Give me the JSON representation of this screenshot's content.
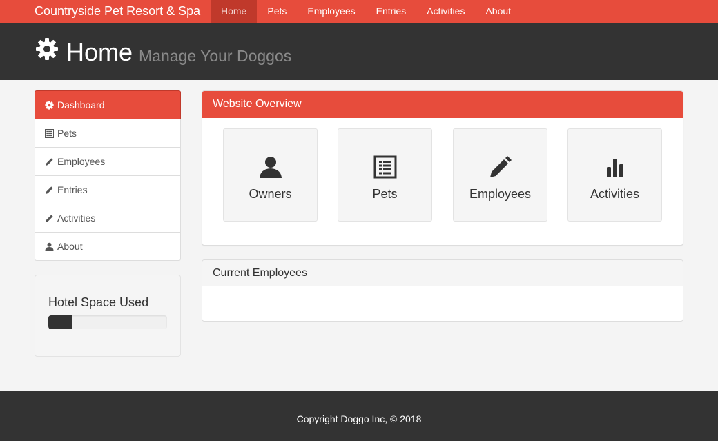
{
  "navbar": {
    "brand": "Countryside Pet Resort & Spa",
    "items": [
      {
        "label": "Home",
        "active": true
      },
      {
        "label": "Pets"
      },
      {
        "label": "Employees"
      },
      {
        "label": "Entries"
      },
      {
        "label": "Activities"
      },
      {
        "label": "About"
      }
    ]
  },
  "header": {
    "icon": "gear-icon",
    "title": "Home",
    "subtitle": "Manage Your Doggos"
  },
  "sidebar": {
    "items": [
      {
        "label": "Dashboard",
        "icon": "gear-icon",
        "active": true
      },
      {
        "label": "Pets",
        "icon": "list-icon"
      },
      {
        "label": "Employees",
        "icon": "pencil-icon"
      },
      {
        "label": "Entries",
        "icon": "pencil-icon"
      },
      {
        "label": "Activities",
        "icon": "pencil-icon"
      },
      {
        "label": "About",
        "icon": "user-icon"
      }
    ]
  },
  "hotel_space": {
    "title": "Hotel Space Used",
    "progress": 0.2
  },
  "overview": {
    "title": "Website Overview",
    "cards": [
      {
        "label": "Owners",
        "icon": "user-icon"
      },
      {
        "label": "Pets",
        "icon": "list-icon"
      },
      {
        "label": "Employees",
        "icon": "pencil-icon"
      },
      {
        "label": "Activities",
        "icon": "bar-chart-icon"
      }
    ]
  },
  "current_employees": {
    "title": "Current Employees"
  },
  "footer": {
    "text": "Copyright Doggo Inc, © 2018"
  },
  "colors": {
    "accent": "#e74c3c",
    "accent_dark": "#c0392b",
    "dark": "#333333"
  }
}
